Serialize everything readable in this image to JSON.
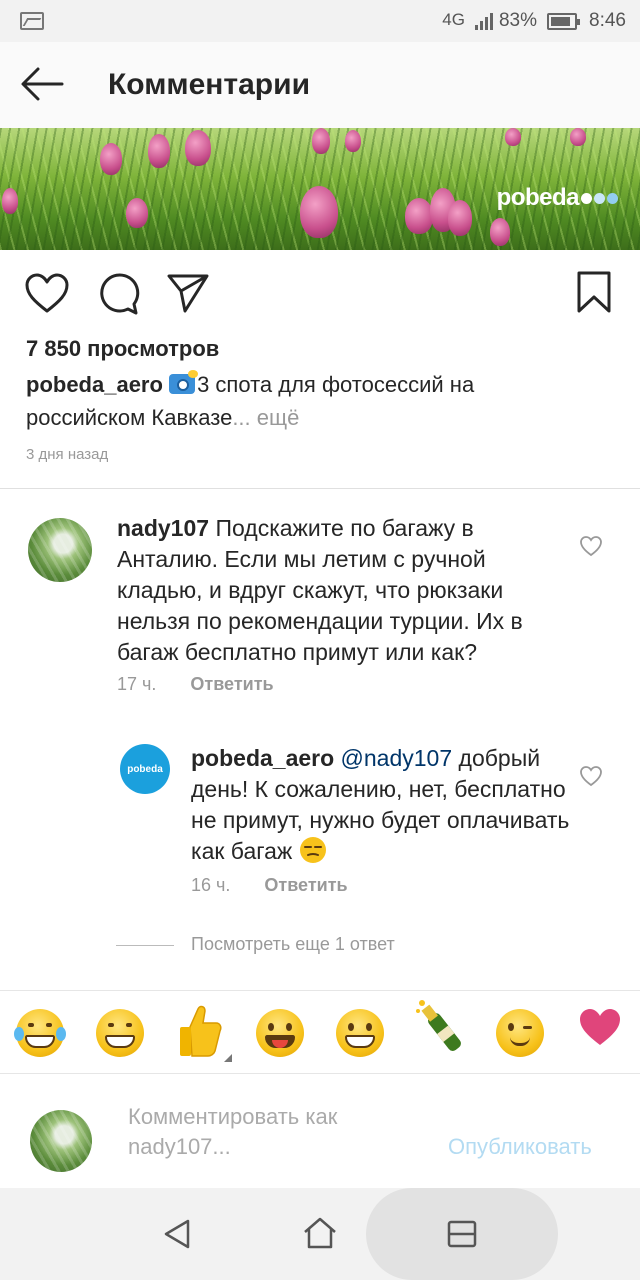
{
  "status_bar": {
    "network": "4G",
    "battery": "83%",
    "time": "8:46"
  },
  "header": {
    "title": "Комментарии"
  },
  "banner": {
    "brand": "pobeda"
  },
  "post": {
    "views": "7 850 просмотров",
    "author": "pobeda_aero",
    "caption": "3 спота для фотосессий на российском Кавказе",
    "more": "... ещё",
    "posted_ago": "3 дня назад"
  },
  "comments": [
    {
      "author": "nady107",
      "text": "Подскажите по багажу в Анталию. Если мы летим с ручной кладью, и вдруг скажут, что рюкзаки нельзя по рекомендации турции. Их в багаж бесплатно примут или как?",
      "time": "17 ч.",
      "reply_label": "Ответить"
    }
  ],
  "reply": {
    "author": "pobeda_aero",
    "avatar_text": "pobeda",
    "mention": "@nady107",
    "text": "добрый день! К сожалению, нет, бесплатно не примут, нужно будет оплачивать как багаж",
    "time": "16 ч.",
    "reply_label": "Ответить"
  },
  "view_more_replies": "Посмотреть еще 1 ответ",
  "emoji_bar": [
    "joy",
    "grin",
    "thumbs-up",
    "smile",
    "grinning",
    "champagne",
    "wink",
    "heart"
  ],
  "compose": {
    "placeholder": "Комментировать как nady107...",
    "publish_label": "Опубликовать"
  },
  "colors": {
    "accent_blue": "#3897f0",
    "publish_disabled": "#b3dbf2",
    "mention": "#003569",
    "brand_blue": "#1ba0dd"
  }
}
